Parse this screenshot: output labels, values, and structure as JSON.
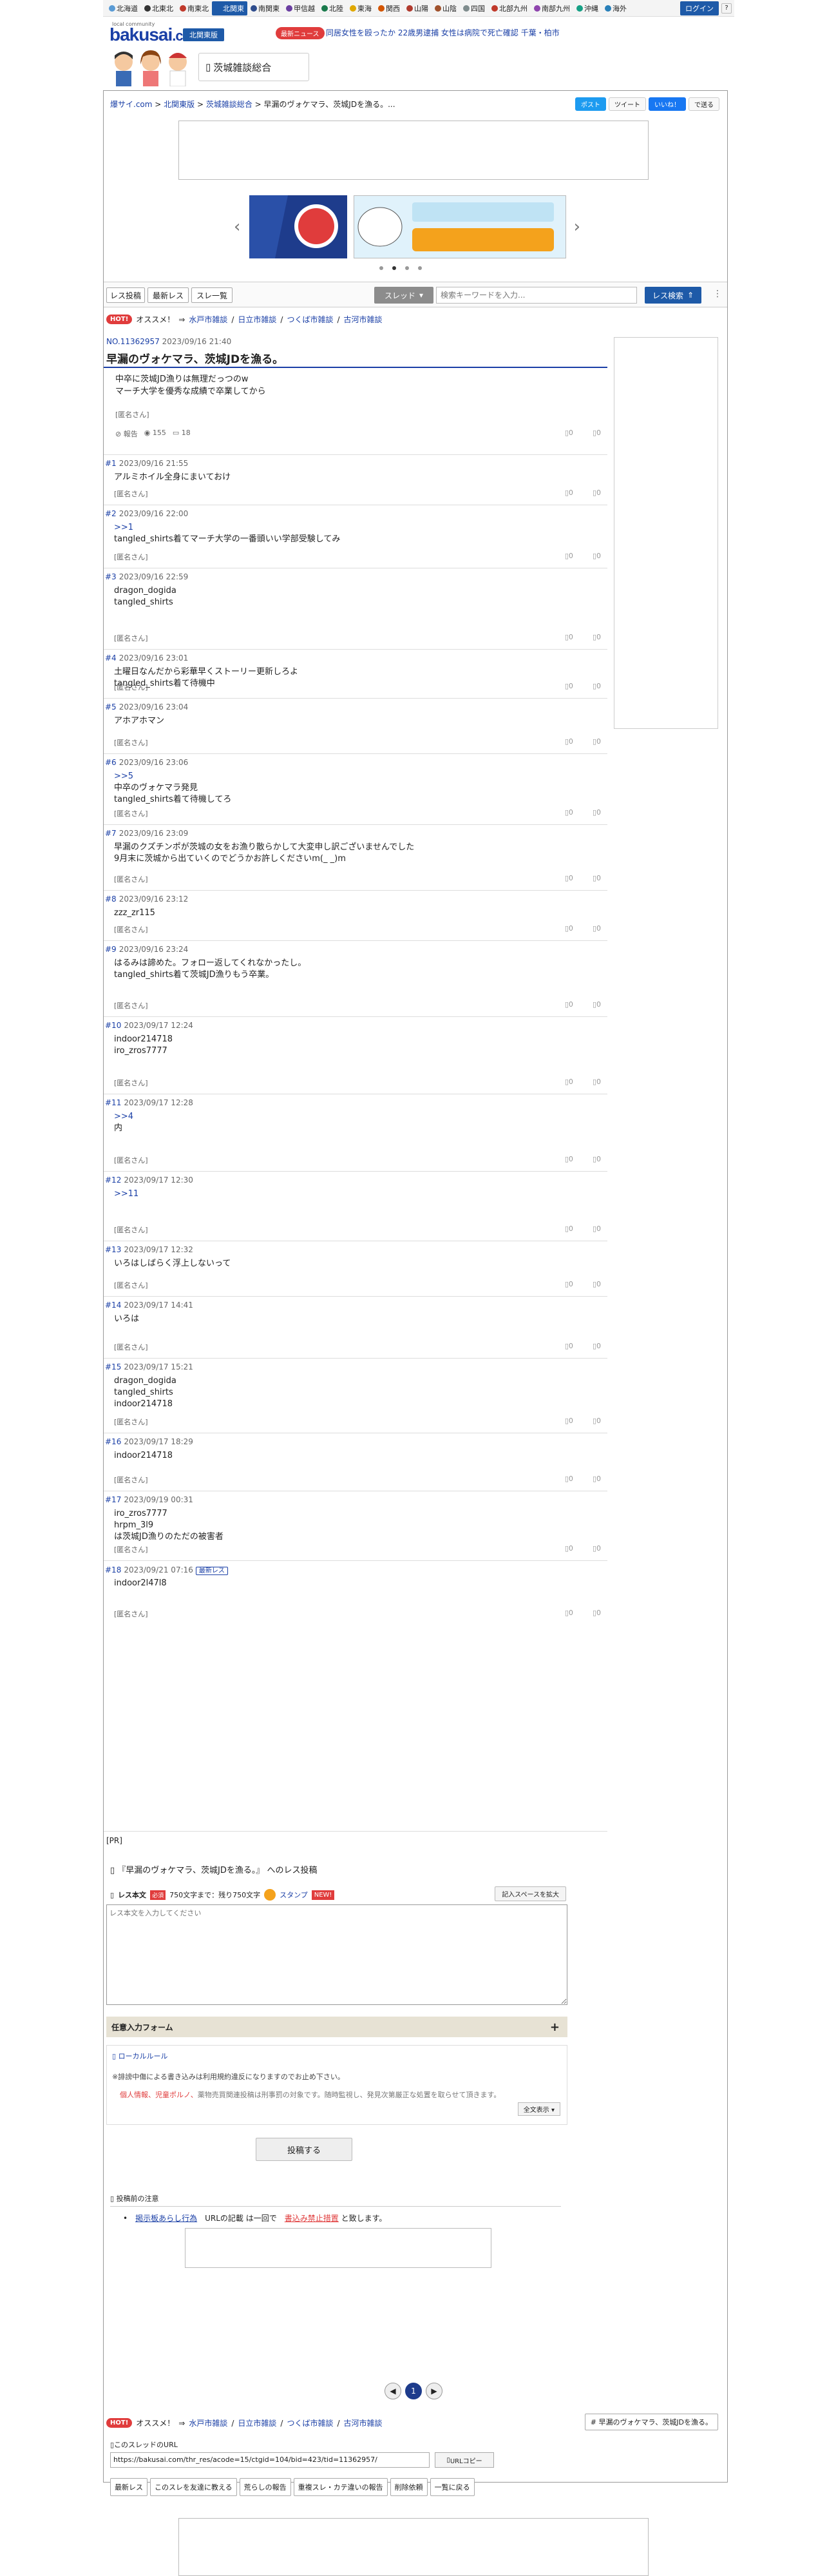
{
  "topbar": {
    "regions": [
      {
        "label": "北海道",
        "color": "#5a9bd5"
      },
      {
        "label": "北東北",
        "color": "#333333"
      },
      {
        "label": "南東北",
        "color": "#c0392b"
      },
      {
        "label": "北関東",
        "color": "#1e5aa8",
        "active": true
      },
      {
        "label": "南関東",
        "color": "#2e4c8c"
      },
      {
        "label": "甲信越",
        "color": "#6a3ea1"
      },
      {
        "label": "北陸",
        "color": "#1a7a4c"
      },
      {
        "label": "東海",
        "color": "#e0a800"
      },
      {
        "label": "関西",
        "color": "#d35400"
      },
      {
        "label": "山陽",
        "color": "#b03a2e"
      },
      {
        "label": "山陰",
        "color": "#a0522d"
      },
      {
        "label": "四国",
        "color": "#7f8c8d"
      },
      {
        "label": "北部九州",
        "color": "#c0392b"
      },
      {
        "label": "南部九州",
        "color": "#8e44ad"
      },
      {
        "label": "沖縄",
        "color": "#16a085"
      },
      {
        "label": "海外",
        "color": "#2980b9"
      }
    ],
    "login": "ログイン"
  },
  "header": {
    "logo_small": "local community",
    "logo": "bakusai",
    "logo_suffix": ".com",
    "area": "北関東版",
    "news_badge": "最新ニュース",
    "news_text": "同居女性を殴ったか 22歳男逮捕 女性は病院で死亡確認 千葉・柏市",
    "board": "茨城雑談総合"
  },
  "breadcrumb": {
    "items": [
      "爆サイ.com",
      "北関東版",
      "茨城雑談総合"
    ],
    "current": "早漏のヴォケマラ、茨城JDを漁る。..."
  },
  "share": {
    "twitter": "ポスト",
    "tweet": "ツイート",
    "like": "いいね！",
    "save": "で送る"
  },
  "nav": {
    "res_post": "レス投稿",
    "latest_res": "最新レス",
    "thread_list": "スレ一覧",
    "search_select": "スレッド",
    "search_placeholder": "検索キーワードを入力...",
    "search_btn": "レス検索"
  },
  "osusume": {
    "hot": "HOT!",
    "label": "オススメ！",
    "links": [
      "水戸市雑談",
      "日立市雑談",
      "つくば市雑談",
      "古河市雑談"
    ]
  },
  "thread": {
    "id": "NO.11362957",
    "date": "2023/09/16 21:40",
    "title": "早漏のヴォケマラ、茨城JDを漁る。",
    "body": "中卒に茨城JD漁りは無理だっつのw\nマーチ大学を優秀な成績で卒業してから",
    "name": "[匿名さん]",
    "report": "報告",
    "views": "155",
    "count": "18"
  },
  "responses": [
    {
      "num": "#1",
      "date": "2023/09/16 21:55",
      "lines": [
        "アルミホイル全身にまいておけ"
      ],
      "name": "[匿名さん]"
    },
    {
      "num": "#2",
      "date": "2023/09/16 22:00",
      "anchor": ">>1",
      "lines": [
        "tangled_shirts着てマーチ大学の一番頭いい学部受験してみ"
      ],
      "name": "[匿名さん]"
    },
    {
      "num": "#3",
      "date": "2023/09/16 22:59",
      "lines": [
        "dragon_dogida",
        "tangled_shirts"
      ],
      "name": "[匿名さん]"
    },
    {
      "num": "#4",
      "date": "2023/09/16 23:01",
      "lines": [
        "土曜日なんだから彩華早くストーリー更新しろよ",
        "tangled_shirts着て待機中"
      ],
      "name": "[匿名さん]"
    },
    {
      "num": "#5",
      "date": "2023/09/16 23:04",
      "lines": [
        "アホアホマン"
      ],
      "name": "[匿名さん]"
    },
    {
      "num": "#6",
      "date": "2023/09/16 23:06",
      "anchor": ">>5",
      "lines": [
        "中卒のヴォケマラ発見",
        "tangled_shirts着て待機してろ"
      ],
      "name": "[匿名さん]"
    },
    {
      "num": "#7",
      "date": "2023/09/16 23:09",
      "lines": [
        "早漏のクズチンポが茨城の女をお漁り散らかして大変申し訳ございませんでした",
        "9月末に茨城から出ていくのでどうかお許しくださいm(_ _)m"
      ],
      "name": "[匿名さん]"
    },
    {
      "num": "#8",
      "date": "2023/09/16 23:12",
      "lines": [
        "zzz_zr115"
      ],
      "name": "[匿名さん]"
    },
    {
      "num": "#9",
      "date": "2023/09/16 23:24",
      "lines": [
        "はるみは諦めた。フォロー返してくれなかったし。",
        "tangled_shirts着て茨城JD漁りもう卒業。"
      ],
      "name": "[匿名さん]"
    },
    {
      "num": "#10",
      "date": "2023/09/17 12:24",
      "lines": [
        "indoor214718",
        "iro_zros7777"
      ],
      "name": "[匿名さん]"
    },
    {
      "num": "#11",
      "date": "2023/09/17 12:28",
      "anchor": ">>4",
      "lines": [
        "内"
      ],
      "name": "[匿名さん]"
    },
    {
      "num": "#12",
      "date": "2023/09/17 12:30",
      "anchor": ">>11",
      "lines": [
        ""
      ],
      "name": "[匿名さん]"
    },
    {
      "num": "#13",
      "date": "2023/09/17 12:32",
      "lines": [
        "いろはしばらく浮上しないって"
      ],
      "name": "[匿名さん]"
    },
    {
      "num": "#14",
      "date": "2023/09/17 14:41",
      "lines": [
        "いろは"
      ],
      "name": "[匿名さん]"
    },
    {
      "num": "#15",
      "date": "2023/09/17 15:21",
      "lines": [
        "dragon_dogida",
        "tangled_shirts",
        "indoor214718"
      ],
      "name": "[匿名さん]"
    },
    {
      "num": "#16",
      "date": "2023/09/17 18:29",
      "lines": [
        "indoor214718"
      ],
      "name": "[匿名さん]"
    },
    {
      "num": "#17",
      "date": "2023/09/19 00:31",
      "lines": [
        "iro_zros7777",
        "hrpm_3l9",
        "は茨城JD漁りのただの被害者"
      ],
      "name": "[匿名さん]"
    },
    {
      "num": "#18",
      "date": "2023/09/21 07:16",
      "badge": "最新レス",
      "lines": [
        "indoor2l47l8"
      ],
      "name": "[匿名さん]"
    }
  ],
  "pr": "[PR]",
  "post": {
    "title": "『早漏のヴォケマラ、茨城JDを漁る。』 へのレス投稿",
    "label": "レス本文",
    "required": "必須",
    "limit": "750文字まで：残り750文字",
    "stamp": "スタンプ",
    "new": "NEW!",
    "space_btn": "記入スペースを拡大",
    "placeholder": "レス本文を入力してください",
    "optional": "任意入力フォーム",
    "local_rule": "ローカルルール",
    "rule1": "※誹謗中傷による書き込みは利用規約違反になりますのでお止め下さい。",
    "rule2_red": "個人情報、児童ポルノ、",
    "rule2": "薬物売買関連投稿は刑事罰の対象です。随時監視し、発見次第厳正な処置を取らせて頂きます。",
    "more": "全文表示",
    "submit": "投稿する"
  },
  "notice": {
    "title": "投稿前の注意",
    "item_link": "掲示板あらし行為",
    "item_mid": "URLの記載 は一回で",
    "item_red": "書込み禁止措置",
    "item_end": "と致します。"
  },
  "pager": {
    "prev": "◀",
    "current": "1",
    "next": "▶"
  },
  "title_btn": "# 早漏のヴォケマラ、茨城JDを漁る。",
  "url": {
    "label": "このスレッドのURL",
    "value": "https://bakusai.com/thr_res/acode=15/ctgid=104/bid=423/tid=11362957/",
    "copy": "URLコピー"
  },
  "bottom_btns": [
    "最新レス",
    "このスレを友達に教える",
    "荒らしの報告",
    "重複スレ・カテ違いの報告",
    "削除依頼",
    "一覧に戻る"
  ],
  "colors": {
    "accent": "#1e5aa8",
    "hot": "#e03c3c",
    "link": "#1a3fa6"
  }
}
